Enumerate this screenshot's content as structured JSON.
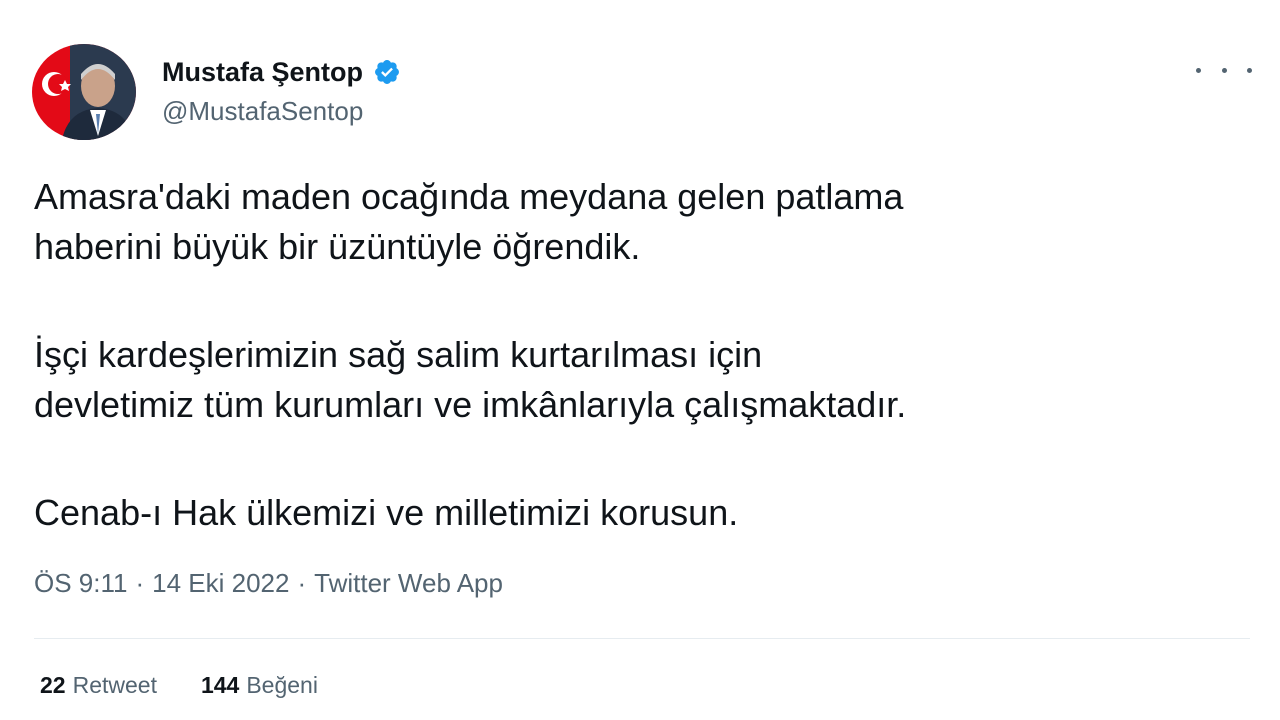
{
  "author": {
    "display_name": "Mustafa Şentop",
    "handle": "@MustafaSentop",
    "verified": true
  },
  "tweet": {
    "paragraphs": [
      {
        "line1": "Amasra'daki maden ocağında meydana gelen patlama",
        "line2": "haberini büyük bir üzüntüyle öğrendik."
      },
      {
        "line1": "İşçi kardeşlerimizin sağ salim kurtarılması için",
        "line2": "devletimiz tüm kurumları ve imkânlarıyla çalışmaktadır."
      },
      {
        "line1": "Cenab-ı Hak ülkemizi ve milletimizi korusun."
      }
    ],
    "time": "ÖS 9:11",
    "separator": "·",
    "date": "14 Eki 2022",
    "source": "Twitter Web App"
  },
  "stats": {
    "retweets": {
      "count": "22",
      "label": "Retweet"
    },
    "likes": {
      "count": "144",
      "label": "Beğeni"
    }
  },
  "colors": {
    "verified_badge": "#1d9bf0",
    "primary_text": "#0f1419",
    "secondary_text": "#536471",
    "flag_red": "#e30a17"
  },
  "icons": {
    "verified": "verified-badge-icon",
    "more": "more-dots-icon"
  }
}
